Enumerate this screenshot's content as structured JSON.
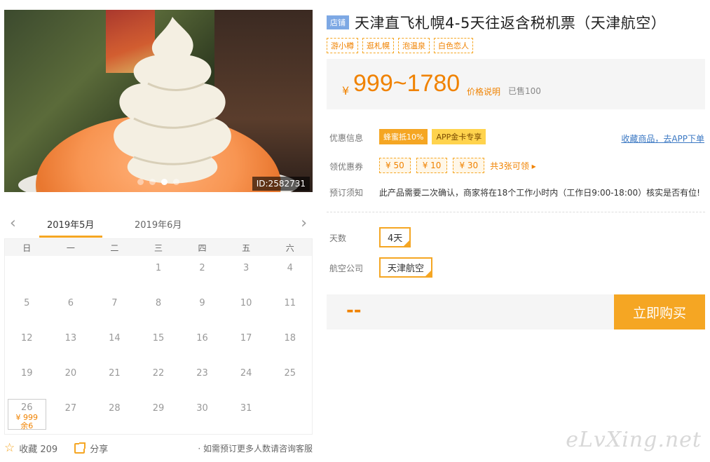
{
  "photo": {
    "id_label": "ID:2582731",
    "slide_count": 4,
    "active_slide": 3
  },
  "calendar": {
    "months": [
      "2019年5月",
      "2019年6月"
    ],
    "weekdays": [
      "日",
      "一",
      "二",
      "三",
      "四",
      "五",
      "六"
    ],
    "days": [
      "",
      "",
      "",
      "1",
      "2",
      "3",
      "4",
      "5",
      "6",
      "7",
      "8",
      "9",
      "10",
      "11",
      "12",
      "13",
      "14",
      "15",
      "16",
      "17",
      "18",
      "19",
      "20",
      "21",
      "22",
      "23",
      "24",
      "25",
      "26",
      "27",
      "28",
      "29",
      "30",
      "31",
      ""
    ],
    "selected": {
      "day": "26",
      "price": "¥ 999",
      "left": "余6"
    }
  },
  "actions": {
    "favorite": "收藏 209",
    "share": "分享",
    "note": "· 如需预订更多人数请咨询客服"
  },
  "product": {
    "shop_badge": "店铺",
    "title": "天津直飞札幌4-5天往返含税机票（天津航空）",
    "tags": [
      "游小樽",
      "逛札幌",
      "泡温泉",
      "白色恋人"
    ]
  },
  "price": {
    "currency": "¥",
    "range": "999~1780",
    "explain": "价格说明",
    "sold": "已售100"
  },
  "promo": {
    "label": "优惠信息",
    "badges": [
      "蜂蜜抵10%",
      "APP金卡专享"
    ],
    "fav_app": "收藏商品，去APP下单"
  },
  "coupons": {
    "label": "领优惠券",
    "items": [
      "¥ 50",
      "¥ 10",
      "¥ 30"
    ],
    "more": "共3张可领 ▸"
  },
  "notice": {
    "label": "预订须知",
    "text": "此产品需要二次确认，商家将在18个工作小时内（工作日9:00-18:00）核实是否有位!"
  },
  "options": {
    "days_label": "天数",
    "days_value": "4天",
    "airline_label": "航空公司",
    "airline_value": "天津航空"
  },
  "buy": {
    "total": "--",
    "button": "立即购买"
  },
  "watermark": "eLvXing.net"
}
